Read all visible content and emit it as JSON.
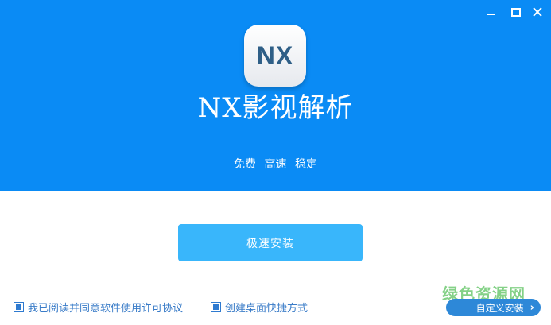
{
  "window": {
    "icons": {
      "minimize": "minimize-icon",
      "maximize": "maximize-icon",
      "close": "close-icon"
    }
  },
  "app": {
    "logo_text": "NX",
    "title": "NX影视解析",
    "tagline": "免费 高速 稳定"
  },
  "install": {
    "quick_label": "极速安装",
    "custom_label": "自定义安装",
    "custom_icon": "chevron-right-icon"
  },
  "options": {
    "agree_label": "我已阅读并同意软件使用许可协议",
    "agree_checked": true,
    "shortcut_label": "创建桌面快捷方式",
    "shortcut_checked": true
  },
  "watermark": {
    "text": "绿色资源网"
  },
  "colors": {
    "header_bg": "#0a8bf5",
    "primary_button": "#39b6fb",
    "secondary_button": "#2d88d8",
    "link_text": "#3a7cc8",
    "watermark": "#5cc25f"
  }
}
